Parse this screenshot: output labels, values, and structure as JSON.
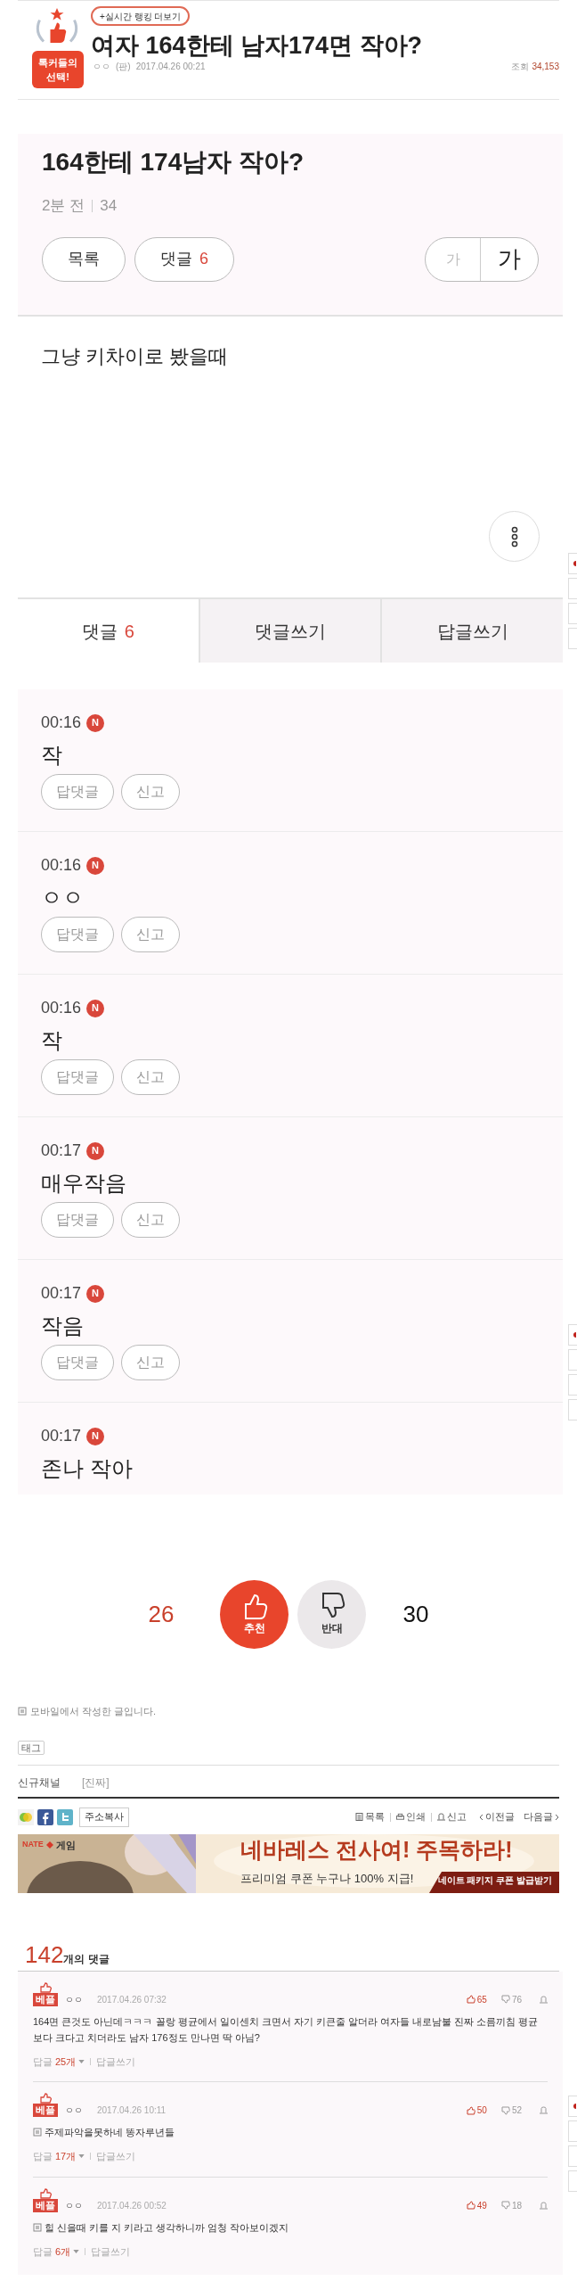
{
  "header": {
    "badge_lines": [
      "톡커들의",
      "선택!"
    ],
    "ranking_link": "+실시간 랭킹 더보기",
    "title": "여자 164한테 남자174면 작아?",
    "author": "ㅇㅇ",
    "board": "(판)",
    "date": "2017.04.26 00:21",
    "views_label": "조회",
    "views": "34,153"
  },
  "post_screenshot": {
    "title": "164한테 174남자 작아?",
    "time": "2분 전",
    "count": "34",
    "buttons": [
      {
        "label": "목록"
      },
      {
        "label": "댓글",
        "count": "6"
      }
    ],
    "font_small": "가",
    "font_large": "가",
    "body": "그냥 키차이로 봤을때",
    "tabs": [
      {
        "label": "댓글",
        "count": "6",
        "selected": true
      },
      {
        "label": "댓글쓰기",
        "selected": false
      },
      {
        "label": "답글쓰기",
        "selected": false
      }
    ],
    "comments": [
      {
        "time": "00:16",
        "badge": "N",
        "text": "작",
        "actions": [
          "답댓글",
          "신고"
        ]
      },
      {
        "time": "00:16",
        "badge": "N",
        "text": "ㅇㅇ",
        "actions": [
          "답댓글",
          "신고"
        ]
      },
      {
        "time": "00:16",
        "badge": "N",
        "text": "작",
        "actions": [
          "답댓글",
          "신고"
        ]
      },
      {
        "time": "00:17",
        "badge": "N",
        "text": "매우작음",
        "actions": [
          "답댓글",
          "신고"
        ]
      },
      {
        "time": "00:17",
        "badge": "N",
        "text": "작음",
        "actions": [
          "답댓글",
          "신고"
        ]
      },
      {
        "time": "00:17",
        "badge": "N",
        "text": "존나 작아"
      }
    ]
  },
  "votes": {
    "up_count": "26",
    "up_label": "추천",
    "down_label": "반대",
    "down_count": "30"
  },
  "mobile_note": "모바일에서 작성한 글입니다.",
  "tag_label": "태그",
  "channel": {
    "label": "신규채널",
    "value": "[진짜]"
  },
  "share": {
    "copy_button": "주소복사",
    "links": [
      {
        "kind": "list",
        "label": "목록"
      },
      {
        "kind": "print",
        "label": "인쇄"
      },
      {
        "kind": "report",
        "label": "신고"
      }
    ],
    "prev": "이전글",
    "next": "다음글"
  },
  "ad": {
    "brand": "NATE",
    "brand_sub": "게임",
    "headline": "네바레스 전사여! 주목하라!",
    "subline": "프리미엄 쿠폰 누구나 100% 지급!",
    "cta": "네이트 패키지 쿠폰 발급받기"
  },
  "comments_section": {
    "count": "142",
    "label": "개의 댓글",
    "comments": [
      {
        "badge": "베플",
        "author": "ㅇㅇ",
        "date": "2017.04.26 07:32",
        "likes": "65",
        "dislikes": "76",
        "mobile": false,
        "text": "164면 큰것도 아닌데ㅋㅋㅋ 꼴랑 평균에서 일이센치 크면서 자기 키큰줄 알더라 여자들 내로남불 진짜 소름끼침 평균보다 크다고 치더라도 남자 176정도 만나면 딱 아님?",
        "replies_label": "답글",
        "replies_count": "25개",
        "write_label": "답글쓰기"
      },
      {
        "badge": "베플",
        "author": "ㅇㅇ",
        "date": "2017.04.26 10:11",
        "likes": "50",
        "dislikes": "52",
        "mobile": true,
        "text": "주제파악을못하네 똥자루년들",
        "replies_label": "답글",
        "replies_count": "17개",
        "write_label": "답글쓰기"
      },
      {
        "badge": "베플",
        "author": "ㅇㅇ",
        "date": "2017.04.26 00:52",
        "likes": "49",
        "dislikes": "18",
        "mobile": true,
        "text": "힐 신을때 키를 지 키라고 생각하니까 엄청 작아보이겠지",
        "replies_label": "답글",
        "replies_count": "6개",
        "write_label": "답글쓰기"
      }
    ]
  }
}
